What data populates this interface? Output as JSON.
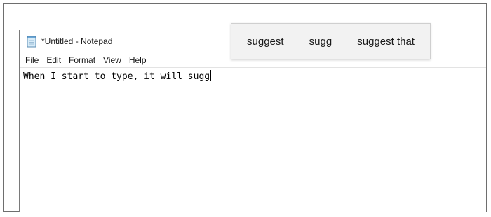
{
  "window": {
    "title": "*Untitled - Notepad",
    "icon": "notepad-icon"
  },
  "menu": {
    "items": [
      "File",
      "Edit",
      "Format",
      "View",
      "Help"
    ]
  },
  "editor": {
    "text": "When I start to type, it will sugg"
  },
  "suggestions": {
    "items": [
      "suggest",
      "sugg",
      "suggest that"
    ]
  },
  "colors": {
    "suggestion_bar_bg": "#f2f2f2",
    "border": "#6e6e6e"
  }
}
